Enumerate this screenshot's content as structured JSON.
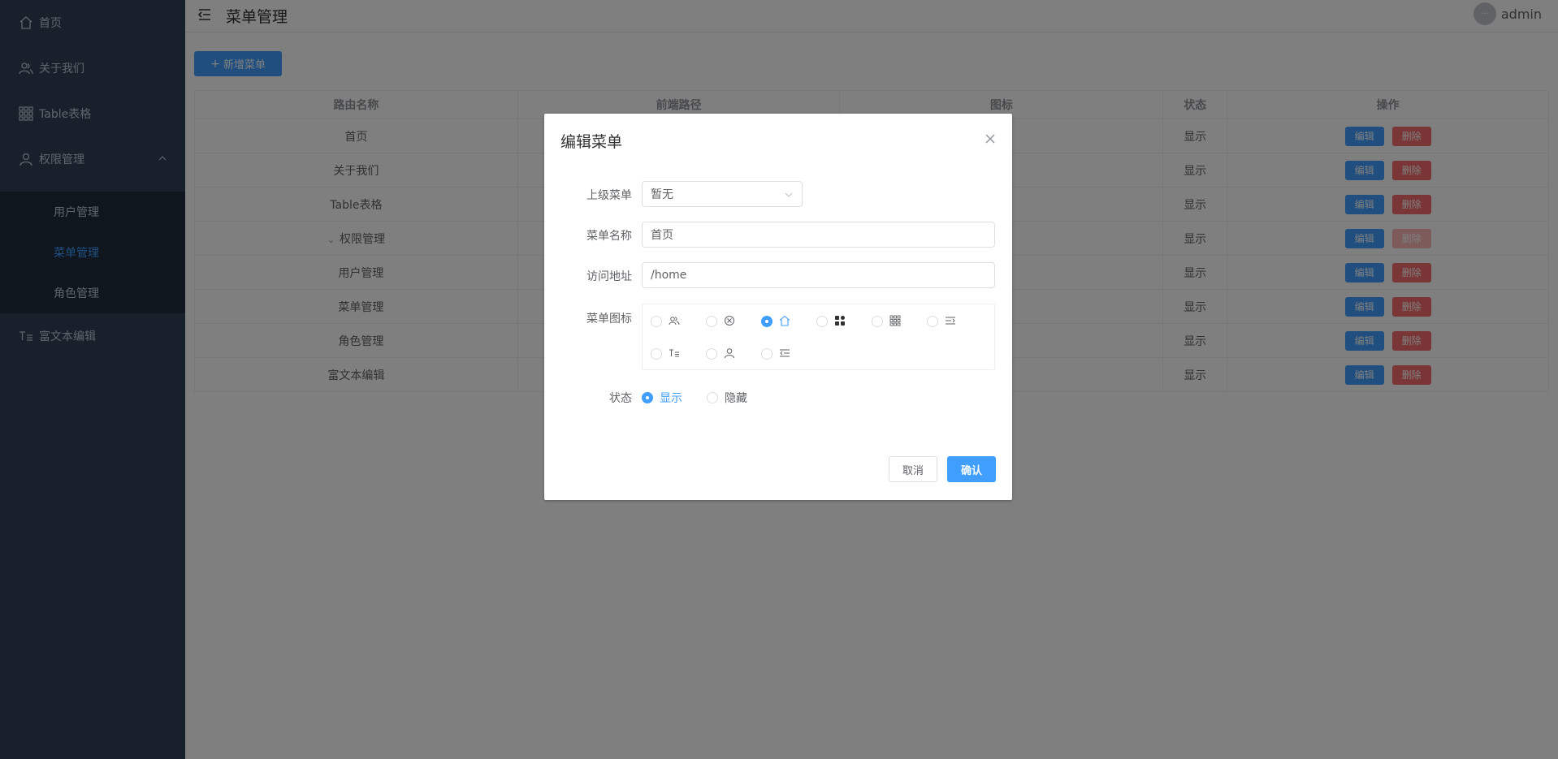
{
  "sidebar": {
    "items": [
      {
        "label": "首页",
        "icon": "home-icon"
      },
      {
        "label": "关于我们",
        "icon": "users-icon"
      },
      {
        "label": "Table表格",
        "icon": "grid-icon"
      },
      {
        "label": "权限管理",
        "icon": "user-icon"
      },
      {
        "label": "富文本编辑",
        "icon": "text-edit-icon"
      }
    ],
    "sub_items": [
      {
        "label": "用户管理"
      },
      {
        "label": "菜单管理"
      },
      {
        "label": "角色管理"
      }
    ]
  },
  "header": {
    "title": "菜单管理",
    "username": "admin",
    "avatar_text": "···"
  },
  "toolbar": {
    "add_label": "新增菜单"
  },
  "table": {
    "columns": [
      "路由名称",
      "前端路径",
      "图标",
      "状态",
      "操作"
    ],
    "rows": [
      {
        "name": "首页",
        "status": "显示"
      },
      {
        "name": "关于我们",
        "status": "显示"
      },
      {
        "name": "Table表格",
        "status": "显示"
      },
      {
        "name": "权限管理",
        "status": "显示"
      },
      {
        "name": "用户管理",
        "status": "显示"
      },
      {
        "name": "菜单管理",
        "status": "显示"
      },
      {
        "name": "角色管理",
        "status": "显示"
      },
      {
        "name": "富文本编辑",
        "status": "显示"
      }
    ],
    "edit_label": "编辑",
    "delete_label": "删除"
  },
  "dialog": {
    "title": "编辑菜单",
    "parent_label": "上级菜单",
    "parent_value": "暂无",
    "name_label": "菜单名称",
    "name_value": "首页",
    "path_label": "访问地址",
    "path_value": "/home",
    "icon_label": "菜单图标",
    "status_label": "状态",
    "status_show": "显示",
    "status_hide": "隐藏",
    "cancel_label": "取消",
    "confirm_label": "确认"
  },
  "colors": {
    "sidebar_bg": "#304156",
    "primary": "#409eff",
    "danger": "#f56c6c"
  }
}
